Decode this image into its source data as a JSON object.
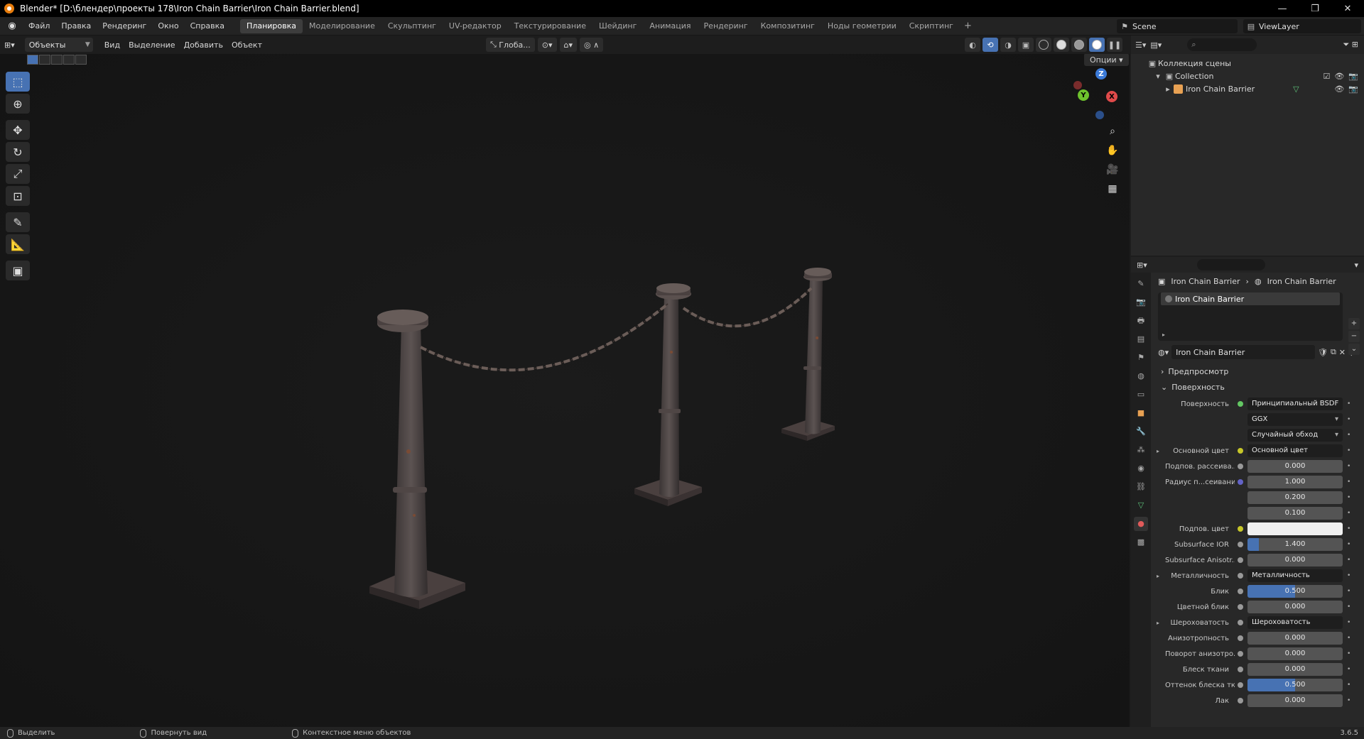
{
  "window": {
    "title": "Blender* [D:\\блендер\\проекты 178\\Iron Chain Barrier\\Iron Chain Barrier.blend]",
    "minimize": "—",
    "maximize": "❐",
    "close": "✕"
  },
  "menu": [
    "Файл",
    "Правка",
    "Рендеринг",
    "Окно",
    "Справка"
  ],
  "workspaces": {
    "tabs": [
      "Планировка",
      "Моделирование",
      "Скульптинг",
      "UV-редактор",
      "Текстурирование",
      "Шейдинг",
      "Анимация",
      "Рендеринг",
      "Композитинг",
      "Ноды геометрии",
      "Скриптинг"
    ],
    "active": "Планировка",
    "add": "+"
  },
  "scene": {
    "label": "Scene",
    "view_layer": "ViewLayer"
  },
  "viewport_header": {
    "mode": "Объекты",
    "menus": [
      "Вид",
      "Выделение",
      "Добавить",
      "Объект"
    ],
    "orientation": "Глоба...",
    "options": "Опции"
  },
  "toolbar": {
    "tools": [
      "select-box",
      "cursor",
      "move",
      "rotate",
      "scale",
      "transform",
      "annotate",
      "measure",
      "add-cube"
    ],
    "active": "select-box"
  },
  "gizmo": {
    "z": "Z",
    "y": "Y",
    "x": "X"
  },
  "outliner": {
    "scene_collection": "Коллекция сцены",
    "collection": "Collection",
    "object": "Iron Chain Barrier"
  },
  "properties": {
    "breadcrumb_object": "Iron Chain Barrier",
    "breadcrumb_material": "Iron Chain Barrier",
    "slot": "Iron Chain Barrier",
    "material_name": "Iron Chain Barrier",
    "sections": {
      "preview": "Предпросмотр",
      "surface": "Поверхность"
    },
    "rows": [
      {
        "label": "Поверхность",
        "type": "link",
        "socket": "green",
        "value": "Принципиальный BSDF"
      },
      {
        "label": "",
        "type": "dropdown",
        "value": "GGX"
      },
      {
        "label": "",
        "type": "dropdown",
        "value": "Случайный обход"
      },
      {
        "label": "Основной цвет",
        "type": "link",
        "socket": "yellow",
        "value": "Основной цвет",
        "expand": true
      },
      {
        "label": "Подпов. рассеива...",
        "type": "number",
        "socket": "grey",
        "value": "0.000",
        "fill": 0
      },
      {
        "label": "Радиус п...сеивания",
        "type": "number",
        "socket": "purple",
        "value": "1.000",
        "fill": 0
      },
      {
        "label": "",
        "type": "number",
        "value": "0.200",
        "fill": 0
      },
      {
        "label": "",
        "type": "number",
        "value": "0.100",
        "fill": 0
      },
      {
        "label": "Подпов. цвет",
        "type": "color",
        "socket": "yellow",
        "value": ""
      },
      {
        "label": "Subsurface IOR",
        "type": "number",
        "socket": "grey",
        "value": "1.400",
        "fill": 0.12
      },
      {
        "label": "Subsurface Anisotr...",
        "type": "number",
        "socket": "grey",
        "value": "0.000",
        "fill": 0
      },
      {
        "label": "Металличность",
        "type": "link",
        "socket": "grey",
        "value": "Металличность",
        "expand": true
      },
      {
        "label": "Блик",
        "type": "number",
        "socket": "grey",
        "value": "0.500",
        "fill": 0.5
      },
      {
        "label": "Цветной блик",
        "type": "number",
        "socket": "grey",
        "value": "0.000",
        "fill": 0
      },
      {
        "label": "Шероховатость",
        "type": "link",
        "socket": "grey",
        "value": "Шероховатость",
        "expand": true
      },
      {
        "label": "Анизотропность",
        "type": "number",
        "socket": "grey",
        "value": "0.000",
        "fill": 0
      },
      {
        "label": "Поворот анизотро...",
        "type": "number",
        "socket": "grey",
        "value": "0.000",
        "fill": 0
      },
      {
        "label": "Блеск ткани",
        "type": "number",
        "socket": "grey",
        "value": "0.000",
        "fill": 0
      },
      {
        "label": "Оттенок блеска тк...",
        "type": "number",
        "socket": "grey",
        "value": "0.500",
        "fill": 0.5
      },
      {
        "label": "Лак",
        "type": "number",
        "socket": "grey",
        "value": "0.000",
        "fill": 0
      }
    ]
  },
  "statusbar": {
    "select": "Выделить",
    "rotate_view": "Повернуть вид",
    "context_menu": "Контекстное меню объектов",
    "version": "3.6.5"
  }
}
